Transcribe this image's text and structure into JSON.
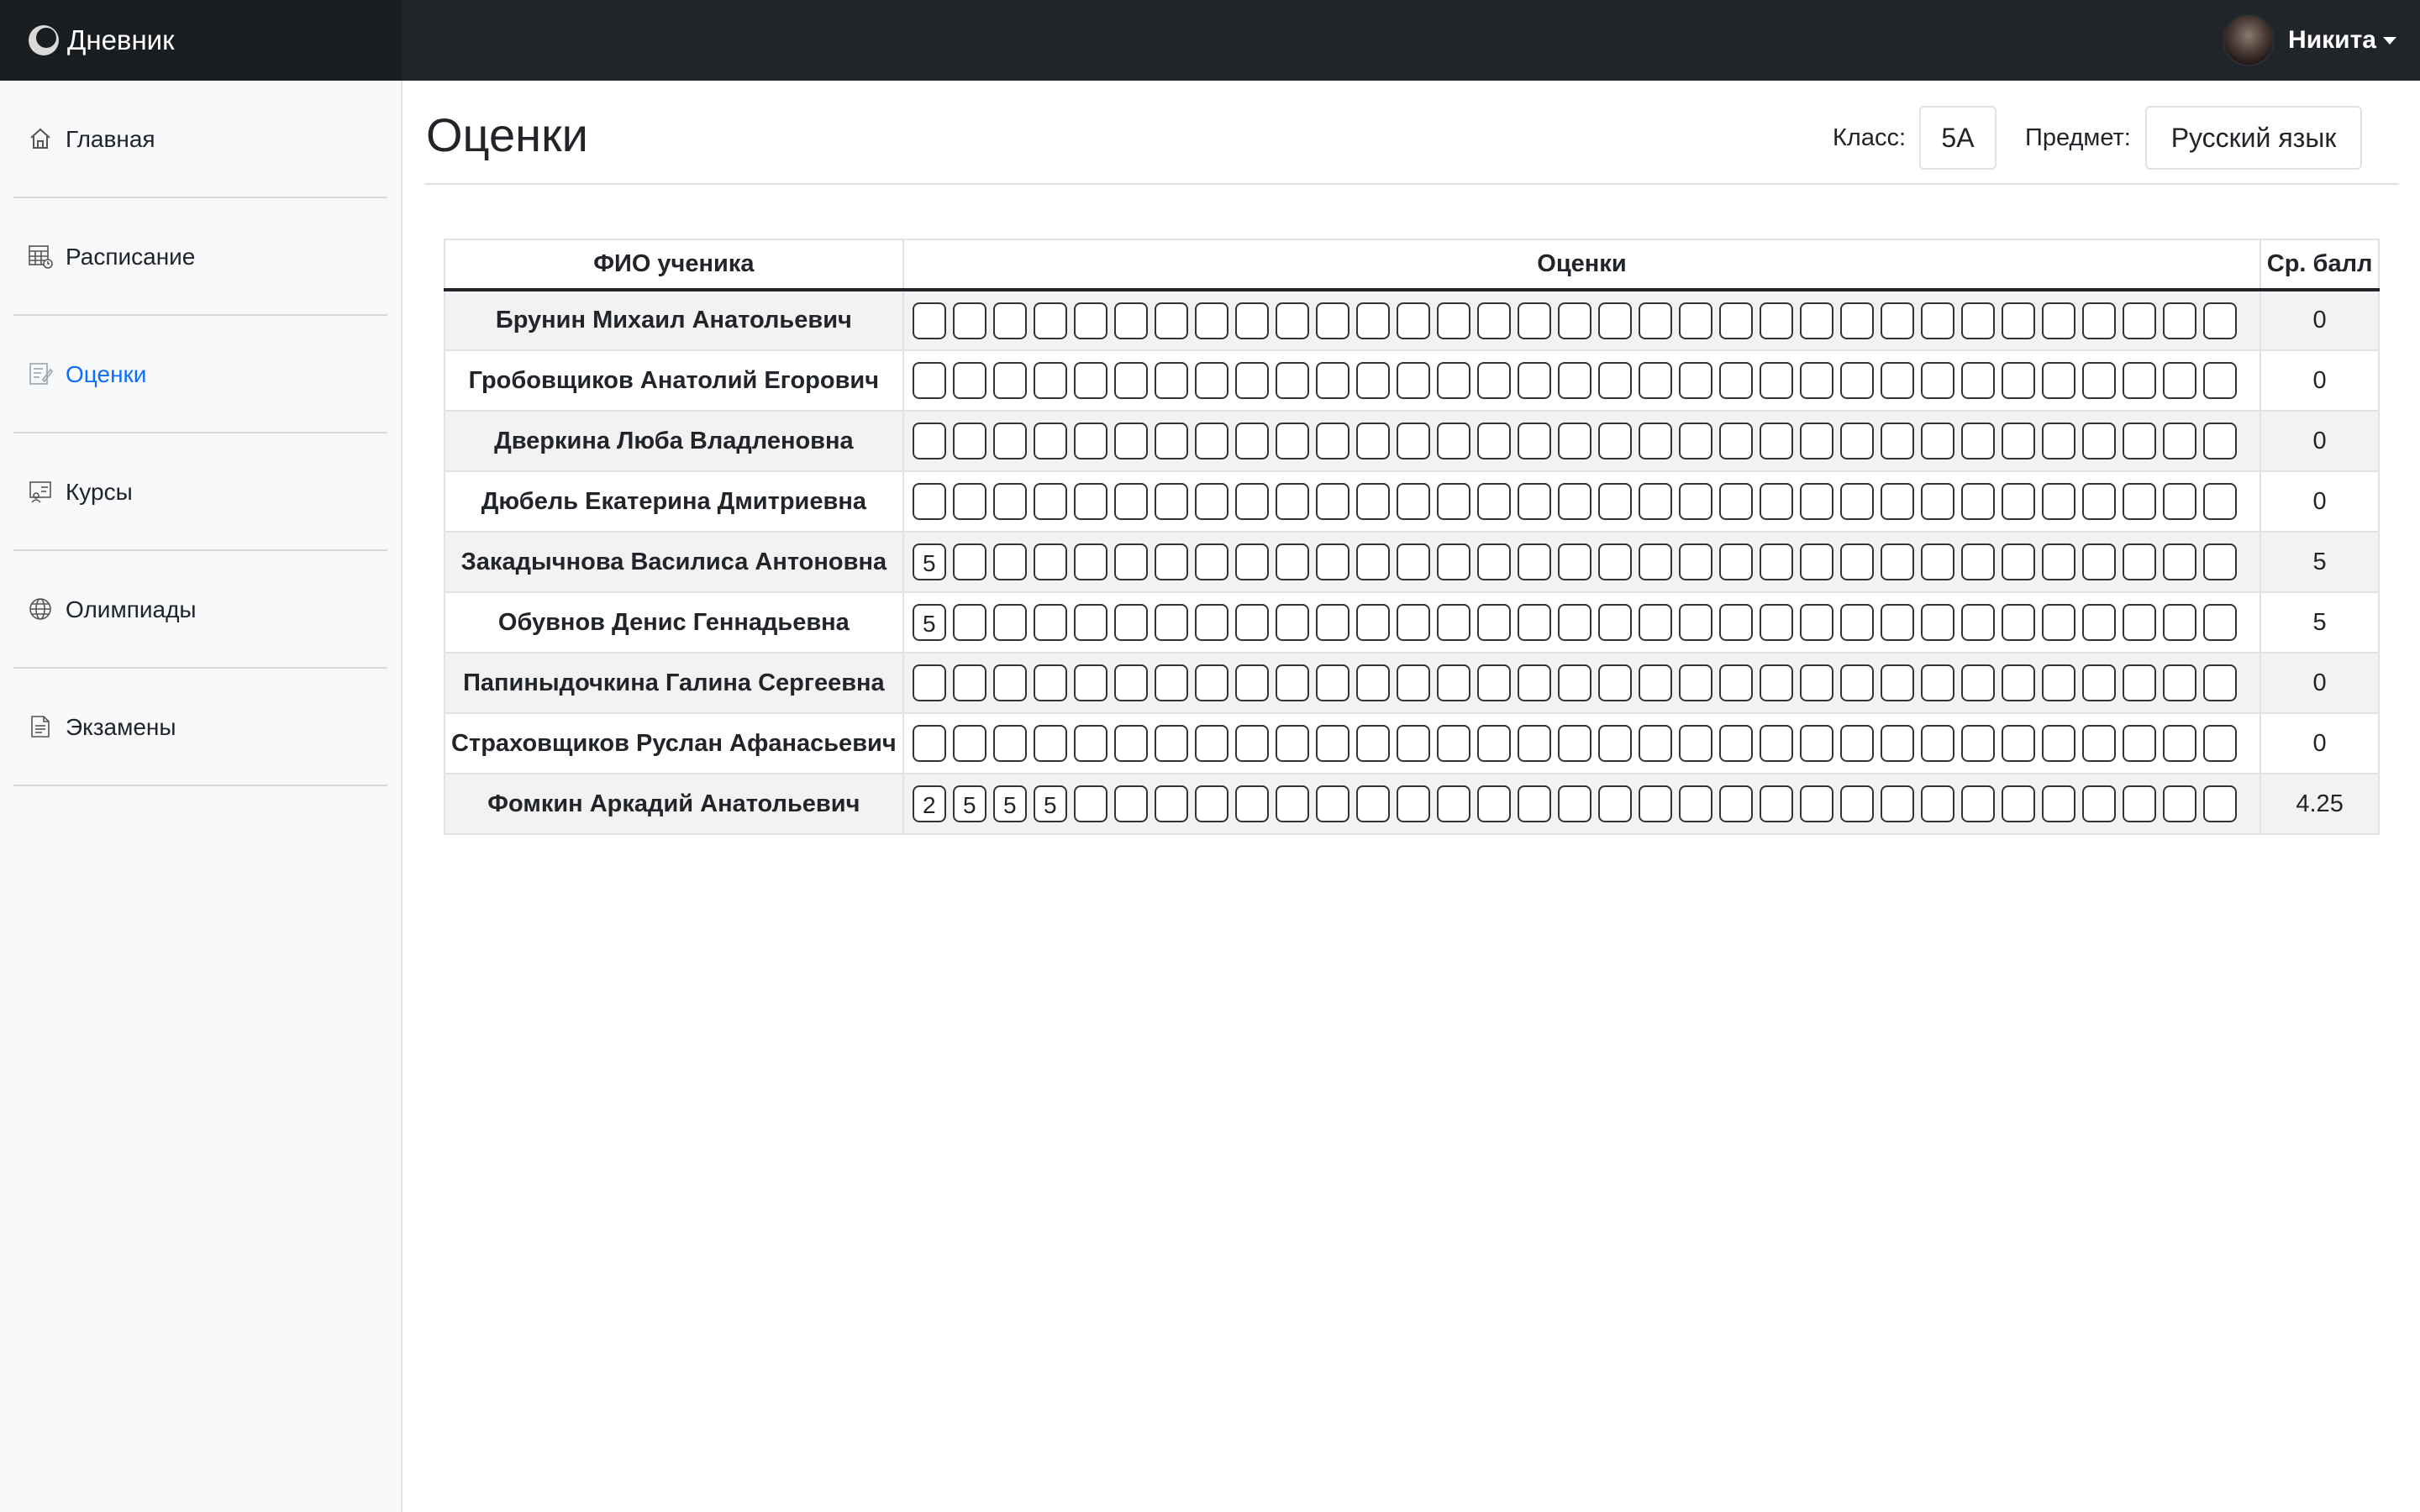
{
  "app": {
    "title": "Дневник",
    "logo_icon": "app-logo-icon"
  },
  "user": {
    "name": "Никита"
  },
  "sidebar": {
    "items": [
      {
        "label": "Главная",
        "icon": "home-icon",
        "active": false
      },
      {
        "label": "Расписание",
        "icon": "calendar-icon",
        "active": false
      },
      {
        "label": "Оценки",
        "icon": "grades-icon",
        "active": true
      },
      {
        "label": "Курсы",
        "icon": "courses-icon",
        "active": false
      },
      {
        "label": "Олимпиады",
        "icon": "globe-icon",
        "active": false
      },
      {
        "label": "Экзамены",
        "icon": "document-icon",
        "active": false
      }
    ]
  },
  "page": {
    "title": "Оценки",
    "class_label": "Класс:",
    "class_value": "5А",
    "subject_label": "Предмет:",
    "subject_value": "Русский язык"
  },
  "table": {
    "headers": {
      "name": "ФИО ученика",
      "marks": "Оценки",
      "avg": "Ср. балл"
    },
    "cells_per_row": 33,
    "rows": [
      {
        "name": "Брунин Михаил Анатольевич",
        "marks": [],
        "avg": "0"
      },
      {
        "name": "Гробовщиков Анатолий Егорович",
        "marks": [],
        "avg": "0"
      },
      {
        "name": "Дверкина Люба Владленовна",
        "marks": [],
        "avg": "0"
      },
      {
        "name": "Дюбель Екатерина Дмитриевна",
        "marks": [],
        "avg": "0"
      },
      {
        "name": "Закадычнова Василиса Антоновна",
        "marks": [
          "5"
        ],
        "avg": "5"
      },
      {
        "name": "Обувнов Денис Геннадьевна",
        "marks": [
          "5"
        ],
        "avg": "5"
      },
      {
        "name": "Папиныдочкина Галина Сергеевна",
        "marks": [],
        "avg": "0"
      },
      {
        "name": "Страховщиков Руслан Афанасьевич",
        "marks": [],
        "avg": "0"
      },
      {
        "name": "Фомкин Аркадий Анатольевич",
        "marks": [
          "2",
          "5",
          "5",
          "5"
        ],
        "avg": "4.25"
      }
    ]
  },
  "colors": {
    "topbar": "#212529",
    "accent": "#0d6efd",
    "sidebar_bg": "#f8f9fa"
  }
}
